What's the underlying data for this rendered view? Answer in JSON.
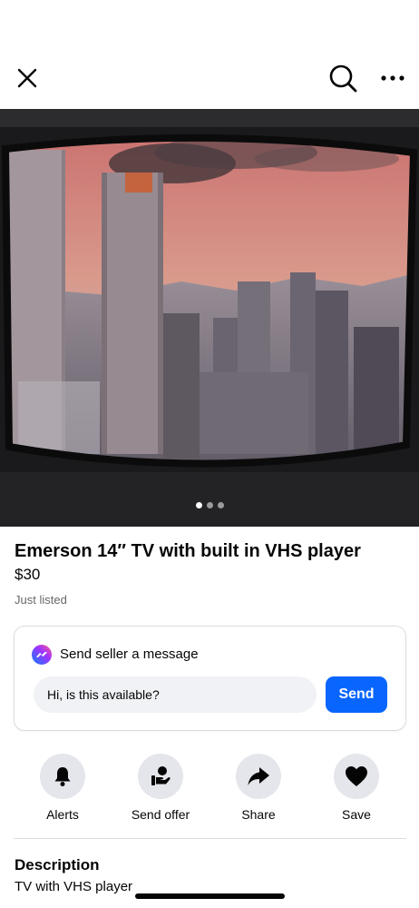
{
  "header": {
    "close_icon": "close-icon",
    "search_icon": "search-icon",
    "more_icon": "more-icon"
  },
  "photo": {
    "description_icon": "listing-photo",
    "carousel_count": 3,
    "carousel_active_index": 0
  },
  "listing": {
    "title": "Emerson 14″ TV with built in VHS player",
    "price": "$30",
    "status": "Just listed"
  },
  "message_card": {
    "heading": "Send seller a message",
    "input_value": "Hi, is this available?",
    "send_label": "Send",
    "accent_color": "#0866ff"
  },
  "actions": [
    {
      "label": "Alerts",
      "icon": "bell-icon"
    },
    {
      "label": "Send offer",
      "icon": "offer-icon"
    },
    {
      "label": "Share",
      "icon": "share-icon"
    },
    {
      "label": "Save",
      "icon": "heart-icon"
    }
  ],
  "description": {
    "heading": "Description",
    "text": "TV with VHS player"
  }
}
